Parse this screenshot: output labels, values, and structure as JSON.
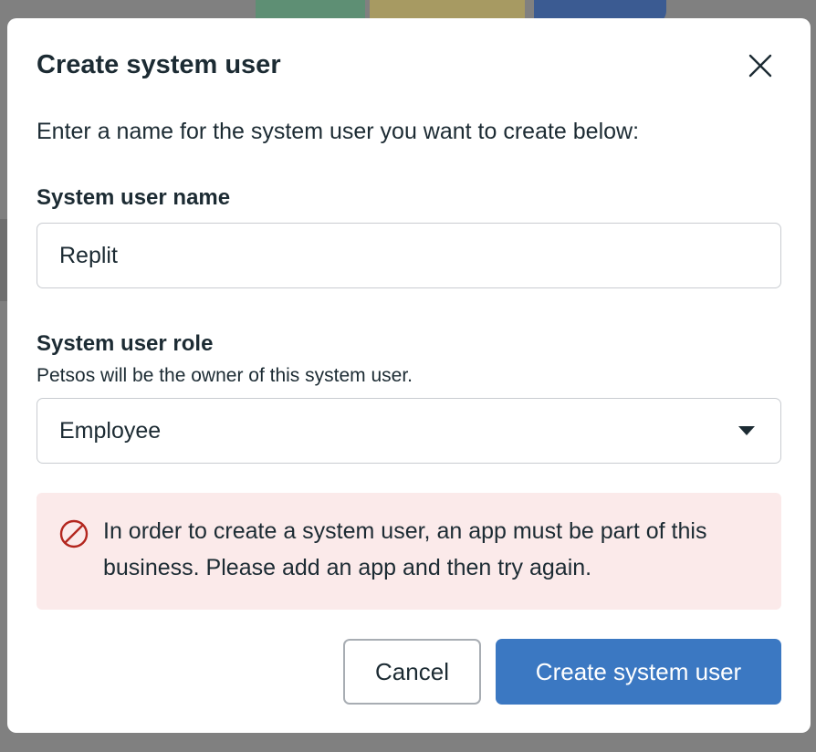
{
  "dialog": {
    "title": "Create system user",
    "intro": "Enter a name for the system user you want to create below:",
    "name_label": "System user name",
    "name_value": "Replit",
    "role_label": "System user role",
    "role_helper": "Petsos will be the owner of this system user.",
    "role_selected": "Employee",
    "error_message": "In order to create a system user, an app must be part of this business. Please add an app and then try again.",
    "cancel_label": "Cancel",
    "create_label": "Create system user"
  },
  "icons": {
    "close": "close-icon",
    "dropdown": "caret-down-icon",
    "error": "prohibited-icon"
  },
  "colors": {
    "primary": "#3b78c2",
    "error_bg": "#fbeaea",
    "error_icon": "#b3261e",
    "text": "#1c2b33",
    "border": "#c9ccd1"
  }
}
